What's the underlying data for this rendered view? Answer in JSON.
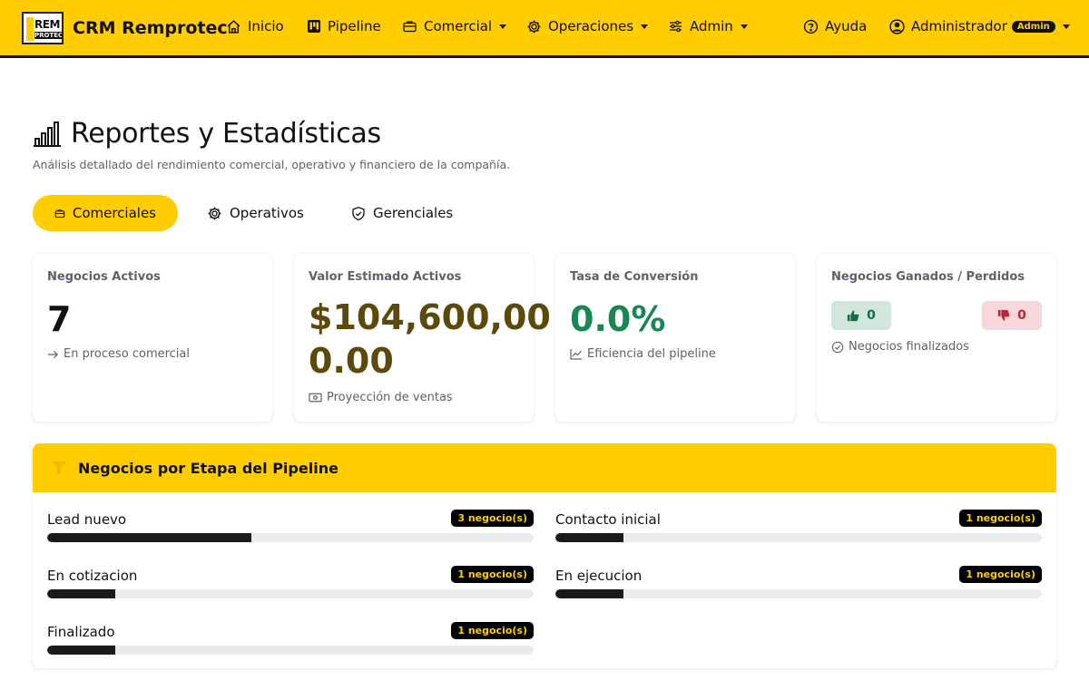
{
  "navbar": {
    "brand": {
      "logo_top": "REM",
      "logo_bottom": "PROTEC",
      "name": "CRM Remprotec"
    },
    "items": [
      {
        "label": "Inicio",
        "icon": "home-icon"
      },
      {
        "label": "Pipeline",
        "icon": "kanban-icon"
      },
      {
        "label": "Comercial",
        "icon": "briefcase-icon",
        "dropdown": true
      },
      {
        "label": "Operaciones",
        "icon": "gear-icon",
        "dropdown": true
      },
      {
        "label": "Admin",
        "icon": "sliders-icon",
        "dropdown": true
      }
    ],
    "help_label": "Ayuda",
    "user": {
      "name": "Administrador",
      "badge": "Admin"
    }
  },
  "header": {
    "title": "Reportes y Estadísticas",
    "subtitle": "Análisis detallado del rendimiento comercial, operativo y financiero de la compañía."
  },
  "tabs": [
    {
      "label": "Comerciales",
      "active": true
    },
    {
      "label": "Operativos",
      "active": false
    },
    {
      "label": "Gerenciales",
      "active": false
    }
  ],
  "cards": {
    "active": {
      "label": "Negocios Activos",
      "value": "7",
      "footer": "En proceso comercial"
    },
    "estimated": {
      "label": "Valor Estimado Activos",
      "value_line1": "$104,600,00",
      "value_line2": "0.00",
      "footer": "Proyección de ventas"
    },
    "conversion": {
      "label": "Tasa de Conversión",
      "value": "0.0%",
      "footer": "Eficiencia del pipeline"
    },
    "won_lost": {
      "label": "Negocios Ganados / Perdidos",
      "won": "0",
      "lost": "0",
      "footer": "Negocios finalizados"
    }
  },
  "pipeline": {
    "title": "Negocios por Etapa del Pipeline",
    "stages": [
      {
        "name": "Lead nuevo",
        "badge": "3 negocio(s)",
        "fraction": 0.42
      },
      {
        "name": "Contacto inicial",
        "badge": "1 negocio(s)",
        "fraction": 0.14
      },
      {
        "name": "En cotizacion",
        "badge": "1 negocio(s)",
        "fraction": 0.14
      },
      {
        "name": "En ejecucion",
        "badge": "1 negocio(s)",
        "fraction": 0.14
      },
      {
        "name": "Finalizado",
        "badge": "1 negocio(s)",
        "fraction": 0.14
      }
    ]
  },
  "colors": {
    "brand_yellow": "#ffcd00",
    "estimated_value": "#5c4a0a",
    "conversion_value": "#198754",
    "won_bg": "#d1e7dd",
    "lost_bg": "#f8d7da"
  }
}
